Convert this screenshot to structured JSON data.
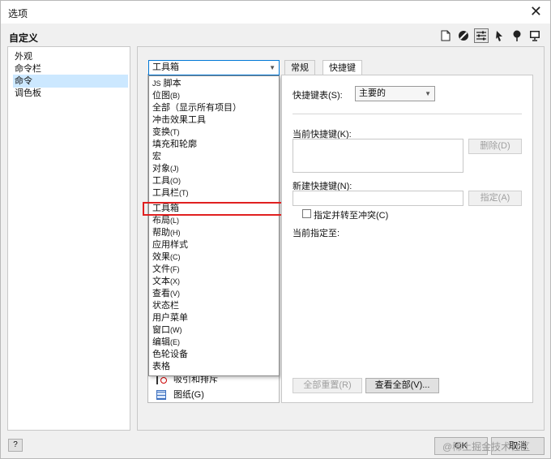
{
  "window": {
    "title": "选项",
    "close_label": "✕"
  },
  "header": {
    "section_title": "自定义"
  },
  "toolbar_icons": [
    "page-icon",
    "circle-slash-icon",
    "sliders-icon",
    "pointer-icon",
    "pin-icon",
    "monitor-icon"
  ],
  "sidebar": {
    "items": [
      {
        "label": "外观"
      },
      {
        "label": "命令栏"
      },
      {
        "label": "命令"
      },
      {
        "label": "调色板"
      }
    ],
    "selected_index": 2
  },
  "commands": {
    "combo_value": "工具箱",
    "dropdown_items": [
      {
        "label": "脚本",
        "prefix": "JS",
        "hotkey": ""
      },
      {
        "label": "位图",
        "hotkey": "(B)"
      },
      {
        "label": "全部（显示所有项目）",
        "hotkey": ""
      },
      {
        "label": "冲击效果工具",
        "hotkey": ""
      },
      {
        "label": "变换",
        "hotkey": "(T)"
      },
      {
        "label": "填充和轮廓",
        "hotkey": ""
      },
      {
        "label": "宏",
        "hotkey": ""
      },
      {
        "label": "对象",
        "hotkey": "(J)"
      },
      {
        "label": "工具",
        "hotkey": "(O)"
      },
      {
        "label": "工具栏",
        "hotkey": "(T)"
      },
      {
        "label": "工具箱",
        "hotkey": ""
      },
      {
        "label": "布局",
        "hotkey": "(L)"
      },
      {
        "label": "帮助",
        "hotkey": "(H)"
      },
      {
        "label": "应用样式",
        "hotkey": ""
      },
      {
        "label": "效果",
        "hotkey": "(C)"
      },
      {
        "label": "文件",
        "hotkey": "(F)"
      },
      {
        "label": "文本",
        "hotkey": "(X)"
      },
      {
        "label": "查看",
        "hotkey": "(V)"
      },
      {
        "label": "状态栏",
        "hotkey": ""
      },
      {
        "label": "用户菜单",
        "hotkey": ""
      },
      {
        "label": "窗口",
        "hotkey": "(W)"
      },
      {
        "label": "编辑",
        "hotkey": "(E)"
      },
      {
        "label": "色轮设备",
        "hotkey": ""
      },
      {
        "label": "表格",
        "hotkey": ""
      }
    ],
    "highlighted_index": 10,
    "list_items_below": [
      {
        "label": "吸引和排斥",
        "icon": "magnet-icon"
      },
      {
        "label": "图纸(G)",
        "icon": "grid-paper-icon"
      }
    ]
  },
  "tabs": [
    {
      "label": "常规"
    },
    {
      "label": "快捷键"
    }
  ],
  "active_tab": 1,
  "shortcut_panel": {
    "table_label": "快捷键表(S):",
    "table_value": "主要的",
    "current_label": "当前快捷键(K):",
    "delete_button": "删除(D)",
    "new_label": "新建快捷键(N):",
    "assign_button": "指定(A)",
    "checkbox_label": "指定并转至冲突(C)",
    "assigned_label": "当前指定至:",
    "reset_all_button": "全部重置(R)",
    "view_all_button": "查看全部(V)..."
  },
  "footer": {
    "help_label": "?",
    "ok_label": "OK",
    "cancel_label": "取消",
    "watermark": "@稀土掘金技术社区"
  }
}
